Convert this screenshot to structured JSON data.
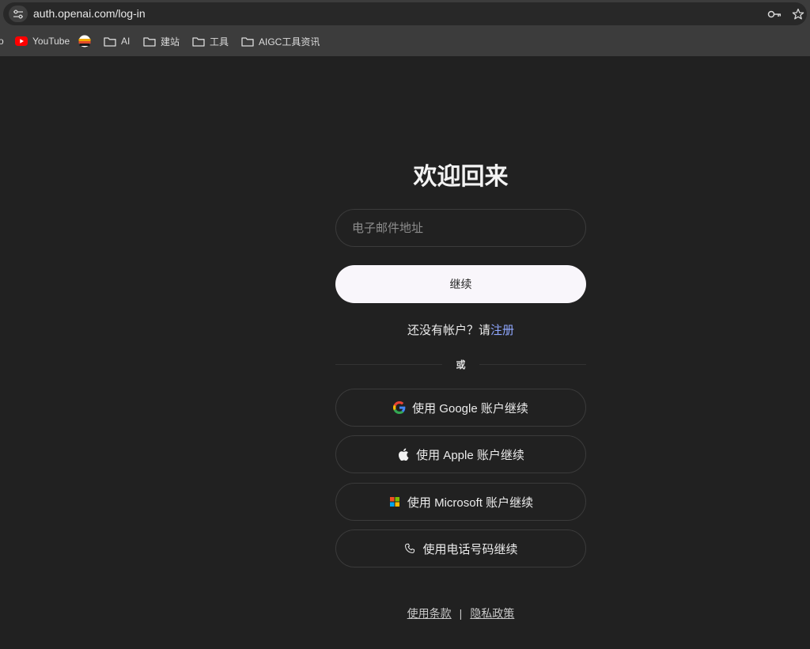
{
  "browser": {
    "url": "auth.openai.com/log-in",
    "bookmarks": [
      {
        "label": "YouTube"
      },
      {
        "label": ""
      },
      {
        "label": "AI"
      },
      {
        "label": "建站"
      },
      {
        "label": "工具"
      },
      {
        "label": "AIGC工具资讯"
      }
    ]
  },
  "login": {
    "heading": "欢迎回来",
    "email_placeholder": "电子邮件地址",
    "continue_label": "继续",
    "no_account_text": "还没有帐户？请",
    "signup_link": "注册",
    "or_label": "或",
    "sso": {
      "google": "使用 Google 账户继续",
      "apple": "使用 Apple 账户继续",
      "microsoft": "使用 Microsoft 账户继续",
      "phone": "使用电话号码继续"
    },
    "footer": {
      "terms": "使用条款",
      "separator": "|",
      "privacy": "隐私政策"
    }
  },
  "icons": {
    "google_colors": [
      "#4285F4",
      "#EA4335",
      "#FBBC05",
      "#34A853"
    ],
    "microsoft_colors": [
      "#F25022",
      "#7FBA00",
      "#00A4EF",
      "#FFB900"
    ],
    "youtube_color": "#FF0000"
  }
}
